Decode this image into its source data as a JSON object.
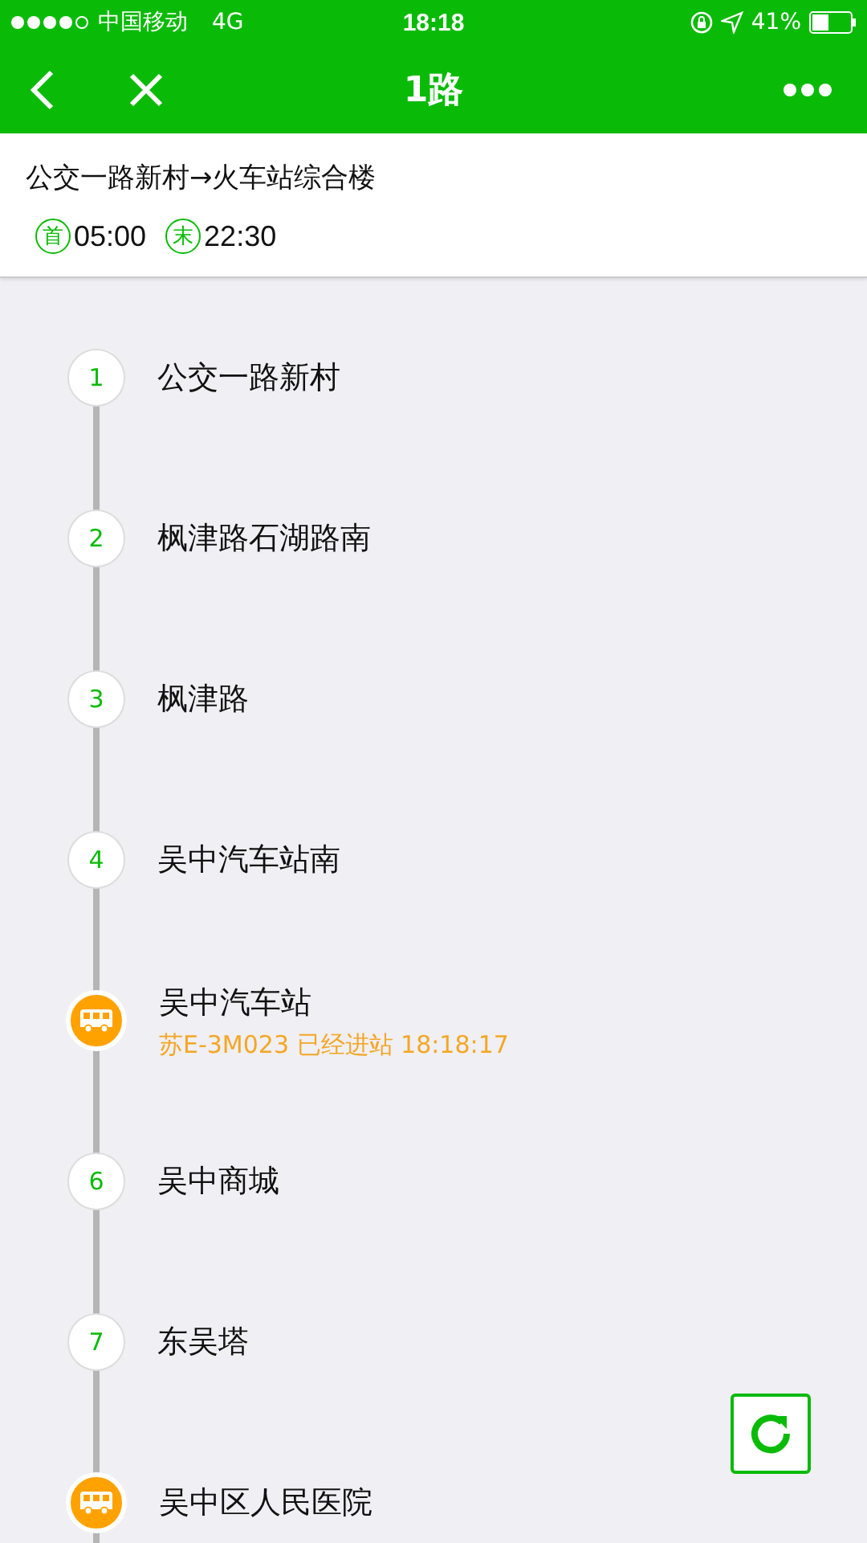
{
  "status_bar": {
    "carrier": "中国移动",
    "network": "4G",
    "time": "18:18",
    "battery": "41%"
  },
  "nav": {
    "title": "1路"
  },
  "route": {
    "direction": "公交一路新村→火车站综合楼",
    "first_label": "首",
    "first_time": "05:00",
    "last_label": "末",
    "last_time": "22:30"
  },
  "stops": [
    {
      "kind": "stop",
      "number": "1",
      "name": "公交一路新村"
    },
    {
      "kind": "stop",
      "number": "2",
      "name": "枫津路石湖路南"
    },
    {
      "kind": "stop",
      "number": "3",
      "name": "枫津路"
    },
    {
      "kind": "stop",
      "number": "4",
      "name": "吴中汽车站南"
    },
    {
      "kind": "bus",
      "name": "吴中汽车站",
      "info": "苏E-3M023 已经进站 18:18:17"
    },
    {
      "kind": "stop",
      "number": "6",
      "name": "吴中商城"
    },
    {
      "kind": "stop",
      "number": "7",
      "name": "东吴塔"
    },
    {
      "kind": "bus",
      "name": "吴中区人民医院"
    }
  ]
}
